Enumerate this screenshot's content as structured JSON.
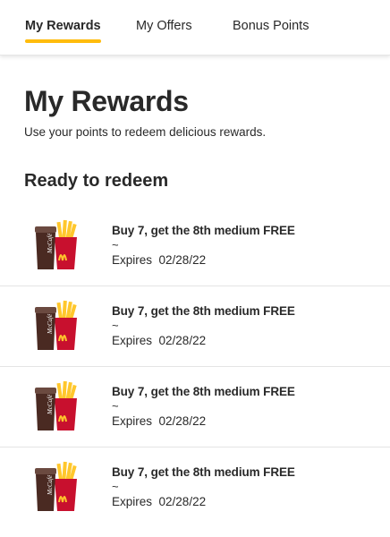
{
  "tabs": [
    {
      "label": "My Rewards",
      "active": true
    },
    {
      "label": "My Offers",
      "active": false
    },
    {
      "label": "Bonus Points",
      "active": false
    }
  ],
  "page": {
    "title": "My Rewards",
    "subtitle": "Use your points to redeem delicious rewards."
  },
  "section": {
    "heading": "Ready to redeem"
  },
  "rewards": [
    {
      "title": "Buy 7, get the 8th medium FREE",
      "separator": "~",
      "expires_label": "Expires",
      "expires_date": "02/28/22",
      "image_icon": "mccafe-cup-and-fries-icon"
    },
    {
      "title": "Buy 7, get the 8th medium FREE",
      "separator": "~",
      "expires_label": "Expires",
      "expires_date": "02/28/22",
      "image_icon": "mccafe-cup-and-fries-icon"
    },
    {
      "title": "Buy 7, get the 8th medium FREE",
      "separator": "~",
      "expires_label": "Expires",
      "expires_date": "02/28/22",
      "image_icon": "mccafe-cup-and-fries-icon"
    },
    {
      "title": "Buy 7, get the 8th medium FREE",
      "separator": "~",
      "expires_label": "Expires",
      "expires_date": "02/28/22",
      "image_icon": "mccafe-cup-and-fries-icon"
    }
  ],
  "colors": {
    "accent": "#ffbc0d",
    "text": "#292929",
    "divider": "#e4e4e4",
    "fries_box": "#c8102e",
    "cup": "#4a2a22",
    "fries": "#ffc72c"
  },
  "images": {
    "cup_lettering": "McCafé"
  }
}
